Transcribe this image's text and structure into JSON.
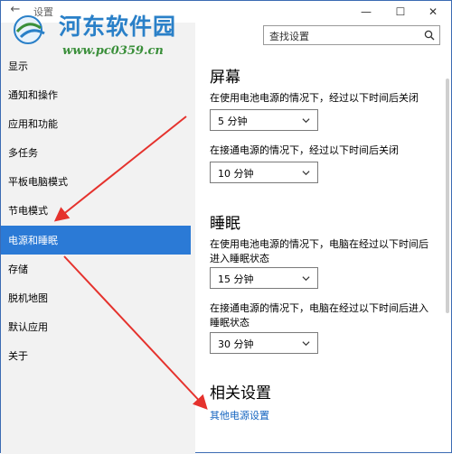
{
  "window": {
    "title_hint": "设置",
    "controls": {
      "minimize": "—",
      "maximize": "☐",
      "close": "✕"
    }
  },
  "watermark": {
    "title": "河东软件园",
    "url": "www.pc0359.cn"
  },
  "search": {
    "placeholder": "查找设置",
    "icon": "search-icon"
  },
  "sidebar": {
    "items": [
      {
        "label": "显示",
        "active": false
      },
      {
        "label": "通知和操作",
        "active": false
      },
      {
        "label": "应用和功能",
        "active": false
      },
      {
        "label": "多任务",
        "active": false
      },
      {
        "label": "平板电脑模式",
        "active": false
      },
      {
        "label": "节电模式",
        "active": false
      },
      {
        "label": "电源和睡眠",
        "active": true
      },
      {
        "label": "存储",
        "active": false
      },
      {
        "label": "脱机地图",
        "active": false
      },
      {
        "label": "默认应用",
        "active": false
      },
      {
        "label": "关于",
        "active": false
      }
    ]
  },
  "main": {
    "screen": {
      "title": "屏幕",
      "battery_desc": "在使用电池电源的情况下，经过以下时间后关闭",
      "battery_value": "5 分钟",
      "plugged_desc": "在接通电源的情况下，经过以下时间后关闭",
      "plugged_value": "10 分钟"
    },
    "sleep": {
      "title": "睡眠",
      "battery_desc": "在使用电池电源的情况下，电脑在经过以下时间后进入睡眠状态",
      "battery_value": "15 分钟",
      "plugged_desc": "在接通电源的情况下，电脑在经过以下时间后进入睡眠状态",
      "plugged_value": "30 分钟"
    },
    "related": {
      "title": "相关设置",
      "link": "其他电源设置"
    }
  },
  "colors": {
    "accent": "#2b7ad6",
    "arrow": "#e5322d",
    "link": "#1565c0"
  }
}
